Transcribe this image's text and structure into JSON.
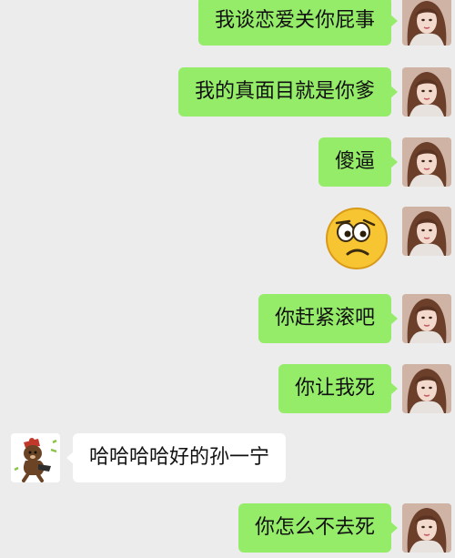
{
  "colors": {
    "background": "#ececec",
    "sent_bubble": "#95ec69",
    "received_bubble": "#ffffff"
  },
  "messages": [
    {
      "side": "sent",
      "type": "text",
      "text": "我谈恋爱关你屁事"
    },
    {
      "side": "sent",
      "type": "text",
      "text": "我的真面目就是你爹"
    },
    {
      "side": "sent",
      "type": "text",
      "text": "傻逼"
    },
    {
      "side": "sent",
      "type": "emoji",
      "icon": "confused-face-emoji"
    },
    {
      "side": "sent",
      "type": "text",
      "text": "你赶紧滚吧"
    },
    {
      "side": "sent",
      "type": "text",
      "text": "你让我死"
    },
    {
      "side": "received",
      "type": "text",
      "text": "哈哈哈哈好的孙一宁"
    },
    {
      "side": "sent",
      "type": "text",
      "text": "你怎么不去死"
    }
  ]
}
